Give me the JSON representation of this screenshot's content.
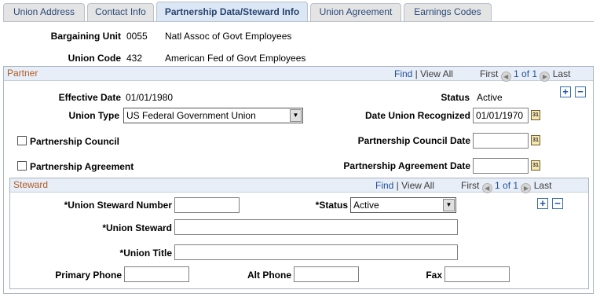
{
  "tabs": [
    {
      "label": "Union Address"
    },
    {
      "label": "Contact Info"
    },
    {
      "label": "Partnership Data/Steward Info"
    },
    {
      "label": "Union Agreement"
    },
    {
      "label": "Earnings Codes"
    }
  ],
  "header": {
    "bargaining_unit_label": "Bargaining Unit",
    "bargaining_unit_code": "0055",
    "bargaining_unit_desc": "Natl Assoc of Govt Employees",
    "union_code_label": "Union Code",
    "union_code_value": "432",
    "union_code_desc": "American Fed of Govt Employees"
  },
  "partner": {
    "title": "Partner",
    "find": "Find",
    "sep": " | ",
    "view_all": "View All",
    "first": "First",
    "range": "1 of 1",
    "last": "Last",
    "effective_date_label": "Effective Date",
    "effective_date": "01/01/1980",
    "status_label": "Status",
    "status": "Active",
    "union_type_label": "Union Type",
    "union_type": "US Federal Government Union",
    "date_recognized_label": "Date Union Recognized",
    "date_recognized": "01/01/1970",
    "council_label": "Partnership Council",
    "council_date_label": "Partnership Council Date",
    "council_date": "",
    "agreement_label": "Partnership Agreement",
    "agreement_date_label": "Partnership Agreement Date",
    "agreement_date": ""
  },
  "steward": {
    "title": "Steward",
    "find": "Find",
    "sep": " | ",
    "view_all": "View All",
    "first": "First",
    "range": "1 of 1",
    "last": "Last",
    "number_label": "*Union Steward Number",
    "number": "",
    "status_label": "*Status",
    "status": "Active",
    "name_label": "*Union Steward",
    "name": "",
    "title_label": "*Union Title",
    "union_title": "",
    "primary_phone_label": "Primary Phone",
    "primary_phone": "",
    "alt_phone_label": "Alt Phone",
    "alt_phone": "",
    "fax_label": "Fax",
    "fax": ""
  },
  "icons": {
    "calendar_text": "31",
    "plus": "+",
    "minus": "−",
    "dropdown": "▼",
    "arrow_left": "◀",
    "arrow_right": "▶"
  },
  "colors": {
    "section_title": "#b05b27",
    "link": "#1f4f9f",
    "tab_bg": "#e4e4e4",
    "active_tab_bg": "#dce7f5"
  }
}
